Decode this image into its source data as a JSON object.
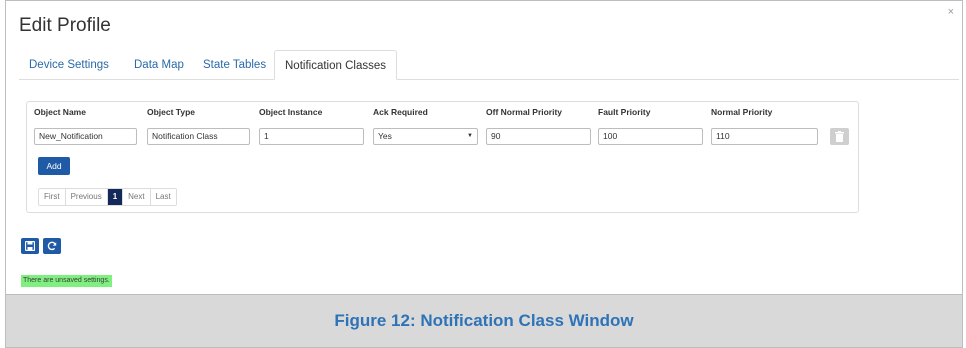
{
  "window": {
    "title": "Edit Profile",
    "close_label": "×"
  },
  "tabs": [
    {
      "label": "Device Settings",
      "active": false
    },
    {
      "label": "Data Map",
      "active": false
    },
    {
      "label": "State Tables",
      "active": false
    },
    {
      "label": "Notification Classes",
      "active": true
    }
  ],
  "table": {
    "headers": [
      "Object Name",
      "Object Type",
      "Object Instance",
      "Ack Required",
      "Off Normal Priority",
      "Fault Priority",
      "Normal Priority"
    ],
    "row": {
      "object_name": "New_Notification",
      "object_type": "Notification Class",
      "object_instance": "1",
      "ack_required": "Yes",
      "off_normal_priority": "90",
      "fault_priority": "100",
      "normal_priority": "110"
    },
    "add_label": "Add"
  },
  "pagination": {
    "first": "First",
    "previous": "Previous",
    "current": "1",
    "next": "Next",
    "last": "Last"
  },
  "actions": {
    "save_icon": "save-icon",
    "refresh_icon": "refresh-icon"
  },
  "status": {
    "message": "There are unsaved settings."
  },
  "caption": {
    "text": "Figure 12: Notification Class Window"
  },
  "colors": {
    "primary_button": "#1f5aa6",
    "current_page": "#12295a",
    "tab_link": "#2a6aa8",
    "unsaved_bg": "#7ff07f",
    "caption_text": "#2e73b8",
    "caption_bg": "#d9d9d9"
  }
}
